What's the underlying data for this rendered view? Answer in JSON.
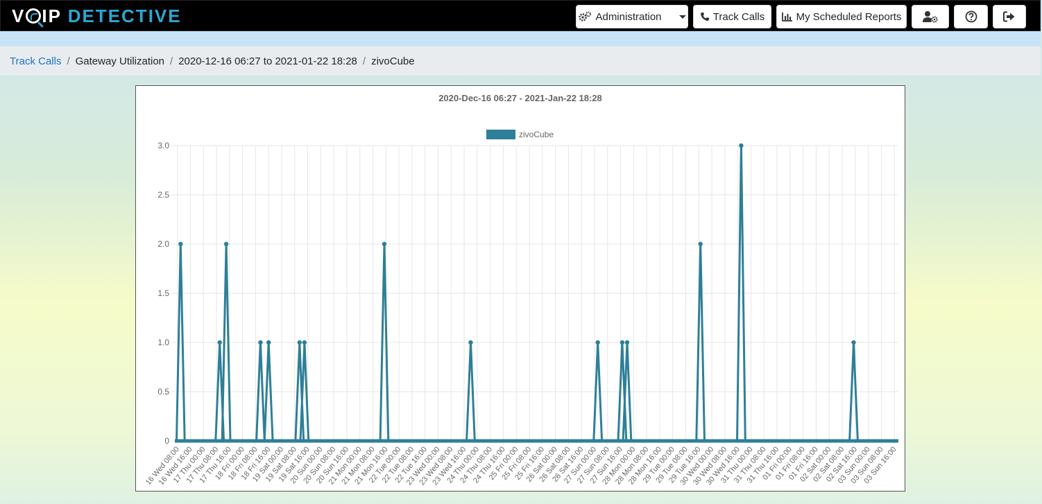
{
  "app": {
    "logo_left": "V",
    "logo_mid": "IP",
    "logo_right": "DETECTIVE"
  },
  "nav": {
    "administration": "Administration",
    "track_calls": "Track Calls",
    "scheduled_reports": "My Scheduled Reports",
    "user_settings_icon": "user-cog-icon",
    "help_icon": "help-icon",
    "logout_icon": "logout-icon"
  },
  "breadcrumb": {
    "item1": "Track Calls",
    "item2": "Gateway Utilization",
    "item3": "2020-12-16 06:27 to 2021-01-22 18:28",
    "item4": "zivoCube"
  },
  "colors": {
    "series": "#2e7f97",
    "link": "#1a73c9",
    "grid": "#e6e6e6"
  },
  "chart_data": {
    "type": "line",
    "title": "2020-Dec-16 06:27 - 2021-Jan-22 18:28",
    "legend": "top",
    "grid": true,
    "ylim": [
      0,
      3
    ],
    "yticks": [
      "0",
      "0.5",
      "1.0",
      "1.5",
      "2.0",
      "2.5",
      "3.0"
    ],
    "x_tick_labels": [
      "16 Wed 08:00",
      "16 Wed 16:00",
      "17 Thu 00:00",
      "17 Thu 08:00",
      "17 Thu 16:00",
      "18 Fri 00:00",
      "18 Fri 08:00",
      "18 Fri 16:00",
      "19 Sat 00:00",
      "19 Sat 08:00",
      "19 Sat 16:00",
      "20 Sun 00:00",
      "20 Sun 08:00",
      "20 Sun 16:00",
      "21 Mon 00:00",
      "21 Mon 08:00",
      "21 Mon 16:00",
      "22 Tue 00:00",
      "22 Tue 08:00",
      "22 Tue 16:00",
      "23 Wed 00:00",
      "23 Wed 08:00",
      "23 Wed 16:00",
      "24 Thu 00:00",
      "24 Thu 08:00",
      "24 Thu 16:00",
      "25 Fri 00:00",
      "25 Fri 08:00",
      "25 Fri 16:00",
      "26 Sat 00:00",
      "26 Sat 08:00",
      "26 Sat 16:00",
      "27 Sun 00:00",
      "27 Sun 08:00",
      "27 Sun 16:00",
      "28 Mon 00:00",
      "28 Mon 08:00",
      "28 Mon 16:00",
      "29 Tue 00:00",
      "29 Tue 08:00",
      "29 Tue 16:00",
      "30 Wed 00:00",
      "30 Wed 08:00",
      "30 Wed 16:00",
      "31 Thu 00:00",
      "31 Thu 08:00",
      "31 Thu 16:00",
      "01 Fri 00:00",
      "01 Fri 08:00",
      "01 Fri 16:00",
      "02 Sat 00:00",
      "02 Sat 08:00",
      "02 Sat 16:00",
      "03 Sun 00:00",
      "03 Sun 08:00",
      "03 Sun 16:00"
    ],
    "series": [
      {
        "name": "zivoCube",
        "x_range": [
          "2020-12-16 06:27",
          "2021-01-03 18:28"
        ],
        "peaks": [
          {
            "x": "2020-12-16 10:00",
            "y": 2
          },
          {
            "x": "2020-12-17 10:00",
            "y": 1
          },
          {
            "x": "2020-12-17 14:00",
            "y": 2
          },
          {
            "x": "2020-12-18 11:00",
            "y": 1
          },
          {
            "x": "2020-12-18 16:00",
            "y": 1
          },
          {
            "x": "2020-12-19 11:00",
            "y": 1
          },
          {
            "x": "2020-12-19 14:00",
            "y": 1
          },
          {
            "x": "2020-12-21 15:00",
            "y": 2
          },
          {
            "x": "2020-12-23 20:00",
            "y": 1
          },
          {
            "x": "2020-12-27 02:00",
            "y": 1
          },
          {
            "x": "2020-12-27 17:00",
            "y": 1
          },
          {
            "x": "2020-12-27 20:00",
            "y": 1
          },
          {
            "x": "2020-12-29 17:00",
            "y": 2
          },
          {
            "x": "2020-12-30 18:00",
            "y": 3
          },
          {
            "x": "2021-01-02 15:00",
            "y": 1
          }
        ]
      }
    ]
  }
}
